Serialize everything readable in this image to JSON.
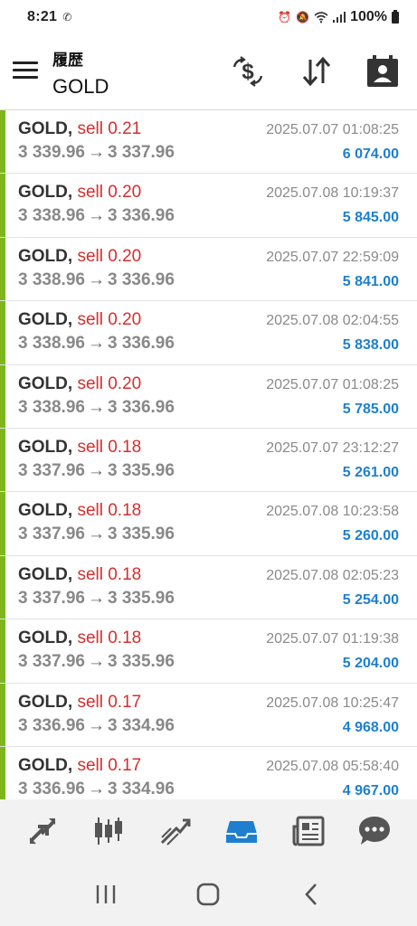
{
  "status": {
    "time": "8:21",
    "battery": "100%"
  },
  "header": {
    "title_top": "履歴",
    "title_main": "GOLD"
  },
  "trades": [
    {
      "symbol": "GOLD,",
      "side": "sell 0.21",
      "open": "3 339.96",
      "close": "3 337.96",
      "time": "2025.07.07 01:08:25",
      "profit": "6 074.00"
    },
    {
      "symbol": "GOLD,",
      "side": "sell 0.20",
      "open": "3 338.96",
      "close": "3 336.96",
      "time": "2025.07.08 10:19:37",
      "profit": "5 845.00"
    },
    {
      "symbol": "GOLD,",
      "side": "sell 0.20",
      "open": "3 338.96",
      "close": "3 336.96",
      "time": "2025.07.07 22:59:09",
      "profit": "5 841.00"
    },
    {
      "symbol": "GOLD,",
      "side": "sell 0.20",
      "open": "3 338.96",
      "close": "3 336.96",
      "time": "2025.07.08 02:04:55",
      "profit": "5 838.00"
    },
    {
      "symbol": "GOLD,",
      "side": "sell 0.20",
      "open": "3 338.96",
      "close": "3 336.96",
      "time": "2025.07.07 01:08:25",
      "profit": "5 785.00"
    },
    {
      "symbol": "GOLD,",
      "side": "sell 0.18",
      "open": "3 337.96",
      "close": "3 335.96",
      "time": "2025.07.07 23:12:27",
      "profit": "5 261.00"
    },
    {
      "symbol": "GOLD,",
      "side": "sell 0.18",
      "open": "3 337.96",
      "close": "3 335.96",
      "time": "2025.07.08 10:23:58",
      "profit": "5 260.00"
    },
    {
      "symbol": "GOLD,",
      "side": "sell 0.18",
      "open": "3 337.96",
      "close": "3 335.96",
      "time": "2025.07.08 02:05:23",
      "profit": "5 254.00"
    },
    {
      "symbol": "GOLD,",
      "side": "sell 0.18",
      "open": "3 337.96",
      "close": "3 335.96",
      "time": "2025.07.07 01:19:38",
      "profit": "5 204.00"
    },
    {
      "symbol": "GOLD,",
      "side": "sell 0.17",
      "open": "3 336.96",
      "close": "3 334.96",
      "time": "2025.07.08 10:25:47",
      "profit": "4 968.00"
    },
    {
      "symbol": "GOLD,",
      "side": "sell 0.17",
      "open": "3 336.96",
      "close": "3 334.96",
      "time": "2025.07.08 05:58:40",
      "profit": "4 967.00"
    }
  ],
  "arrow": "→",
  "bottom_nav": [
    {
      "icon": "quotes-icon",
      "active": false
    },
    {
      "icon": "chart-icon",
      "active": false
    },
    {
      "icon": "trade-icon",
      "active": false
    },
    {
      "icon": "history-icon",
      "active": true
    },
    {
      "icon": "news-icon",
      "active": false
    },
    {
      "icon": "chat-icon",
      "active": false
    }
  ],
  "colors": {
    "accent": "#1e7fd0",
    "sell": "#d32f2f",
    "profit_bar": "#7db71c",
    "nav_inactive": "#555555"
  }
}
